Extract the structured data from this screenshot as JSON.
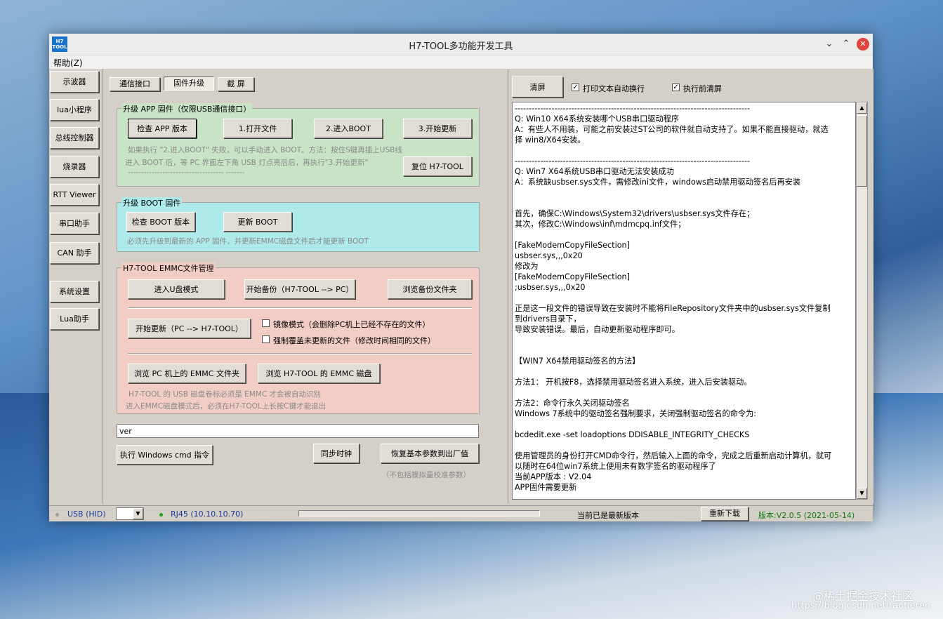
{
  "window": {
    "title": "H7-TOOL多功能开发工具",
    "logo_text": "H7 TOOL"
  },
  "menu": {
    "help": "帮助(Z)"
  },
  "sidebar": {
    "items": [
      "示波器",
      "lua小程序",
      "总线控制器",
      "烧录器",
      "RTT Viewer",
      "串口助手",
      "CAN 助手",
      "系统设置",
      "Lua助手"
    ]
  },
  "tabs": [
    "通信接口",
    "固件升级",
    "截 屏"
  ],
  "app_group": {
    "title": "升级 APP 固件（仅限USB通信接口）",
    "buttons": [
      "检查 APP 版本",
      "1.打开文件",
      "2.进入BOOT",
      "3.开始更新"
    ],
    "reset_button": "复位 H7-TOOL",
    "hints": [
      "如果执行 \"2.进入BOOT\" 失败，可以手动进入 BOOT。方法：按住S键再插上USB线",
      "进入 BOOT 后，等 PC 界面左下角 USB 灯点亮后后，再执行\"3.开始更新\"",
      "------------------------------------        -------"
    ]
  },
  "boot_group": {
    "title": "升级 BOOT 固件",
    "buttons": [
      "检查 BOOT 版本",
      "更新 BOOT"
    ],
    "hint": "必须先升级到最新的 APP 固件，并更新EMMC磁盘文件后才能更新 BOOT"
  },
  "emmc_group": {
    "title": "H7-TOOL EMMC文件管理",
    "buttons": [
      "进入U盘模式",
      "开始备份（H7-TOOL --> PC）",
      "浏览备份文件夹",
      "开始更新（PC --> H7-TOOL）",
      "浏览 PC 机上的 EMMC 文件夹",
      "浏览 H7-TOOL 的 EMMC 磁盘"
    ],
    "checkboxes": [
      {
        "label": "镜像模式（会删除PC机上已经不存在的文件）",
        "checked": false
      },
      {
        "label": "强制覆盖未更新的文件（修改时间相同的文件）",
        "checked": false
      }
    ],
    "hints": [
      "H7-TOOL 的 USB 磁盘卷标必须是 EMMC 才会被自动识别",
      "进入EMMC磁盘模式后，必须在H7-TOOL上长按C键才能退出"
    ]
  },
  "cmd": {
    "value": "ver",
    "exec_button": "执行 Windows cmd 指令",
    "sync_button": "同步时钟",
    "restore_button": "恢复基本参数到出厂值",
    "restore_hint": "（不包括模拟量校准参数）"
  },
  "right_panel": {
    "clear_button": "清屏",
    "wrap_label": "打印文本自动换行",
    "wrap_checked": true,
    "clear_before_label": "执行前清屏",
    "clear_before_checked": true,
    "log_lines": [
      "-----------------------------------------------------------------------------------",
      "Q: Win10 X64系统安装哪个USB串口驱动程序",
      "A：有些人不用装，可能之前安装过ST公司的软件就自动支持了。如果不能直接驱动，就选",
      "择 win8/X64安装。",
      "",
      "-----------------------------------------------------------------------------------",
      "Q: Win7 X64系统USB串口驱动无法安装成功",
      "A：系统缺usbser.sys文件，需修改ini文件，windows启动禁用驱动签名后再安装",
      "",
      "",
      "首先，确保C:\\Windows\\System32\\drivers\\usbser.sys文件存在；",
      "其次，修改C:\\Windows\\inf\\mdmcpq.inf文件；",
      "",
      "[FakeModemCopyFileSection]",
      "usbser.sys,,,0x20",
      "修改为",
      "[FakeModemCopyFileSection]",
      ";usbser.sys,,,0x20",
      "",
      "正是这一段文件的错误导致在安装时不能将FileRepository文件夹中的usbser.sys文件复制",
      "到drivers目录下，",
      "导致安装错误。最后，自动更新驱动程序即可。",
      "",
      "",
      "【WIN7 X64禁用驱动签名的方法】",
      "",
      "方法1： 开机按F8，选择禁用驱动签名进入系统，进入后安装驱动。",
      "",
      "方法2：命令行永久关闭驱动签名",
      "Windows 7系统中的驱动签名强制要求，关闭强制驱动签名的命令为:",
      "",
      "bcdedit.exe -set loadoptions DDISABLE_INTEGRITY_CHECKS",
      "",
      "使用管理员的身份打开CMD命令行，然后输入上面的命令，完成之后重新启动计算机，就可",
      "以随时在64位win7系统上使用未有数字签名的驱动程序了",
      "当前APP版本 : V2.04",
      "APP固件需要更新"
    ]
  },
  "status": {
    "usb": "USB (HID)",
    "rj45": "RJ45 (10.10.10.70)",
    "version_status": "当前已是最新版本",
    "redownload": "重新下载",
    "version": "版本:V2.0.5 (2021-05-14)",
    "usb_dot_color": "#9a9a9a",
    "rj45_dot_color": "#1aa31a",
    "version_color": "#0a7a0a"
  },
  "watermark": {
    "line1": "@稀土掘金技术社区",
    "line2": "https://blog.csdn.net/taotieren"
  }
}
